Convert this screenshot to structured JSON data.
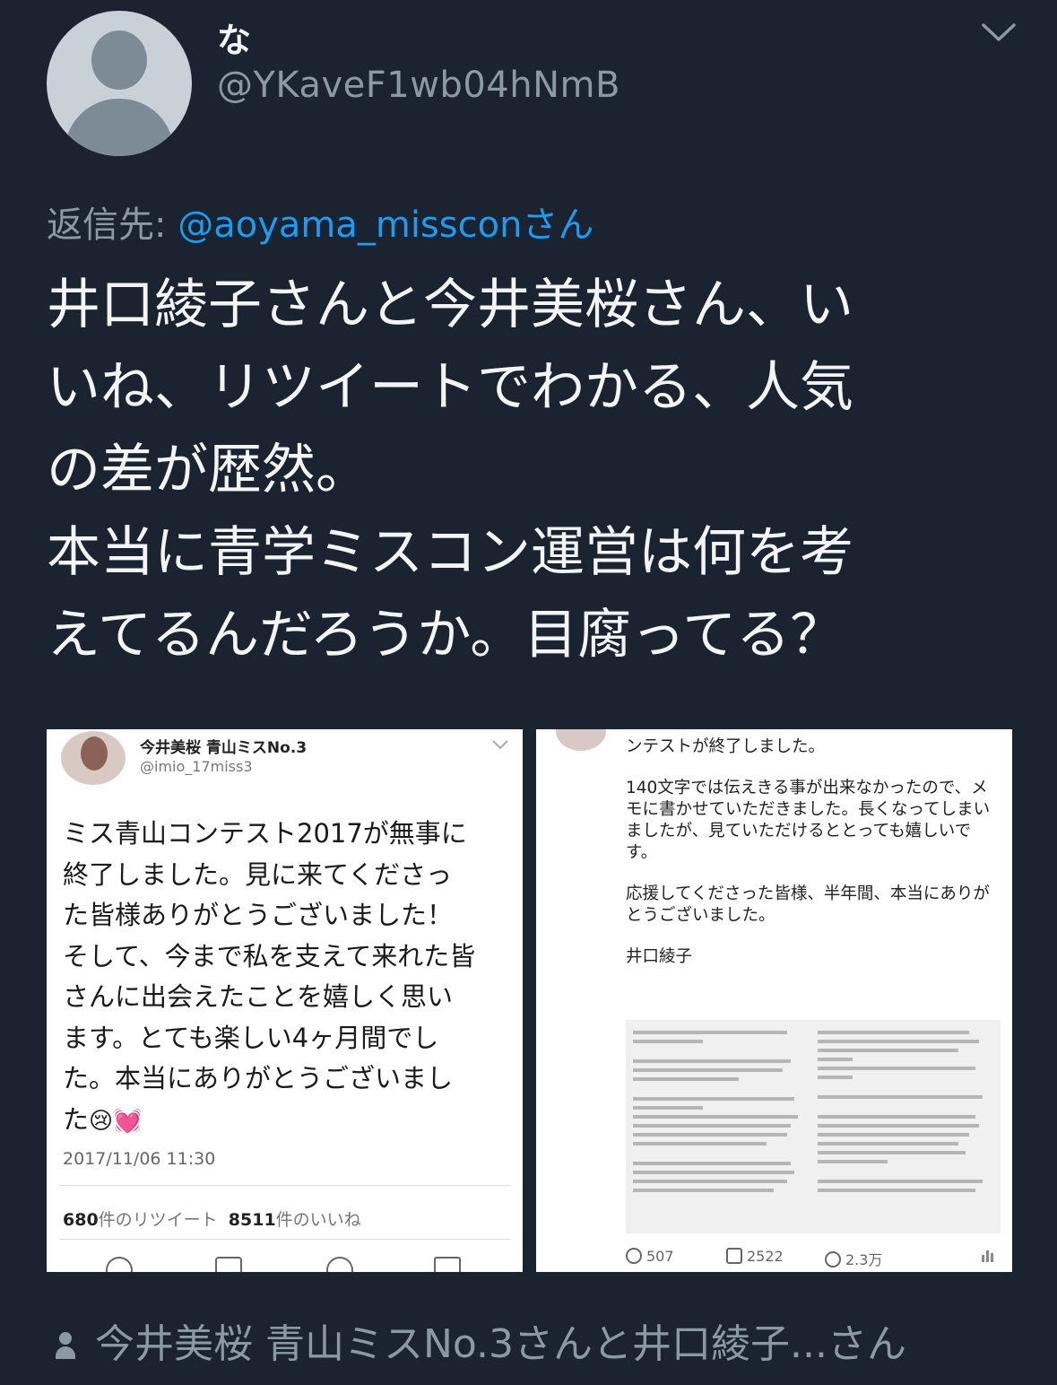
{
  "author": {
    "display_name": "な",
    "handle": "@YKaveF1wb04hNmB"
  },
  "reply": {
    "prefix": "返信先: ",
    "mention": "@aoyama_missconさん"
  },
  "tweet": {
    "text": "井口綾子さんと今井美桜さん、い\nいね、リツイートでわかる、人気\nの差が歴然。\n本当に青学ミスコン運営は何を考\nえてるんだろうか。目腐ってる？"
  },
  "attached_1": {
    "name": "今井美桜 青山ミスNo.3",
    "handle": "@imio_17miss3",
    "body": "ミス青山コンテスト2017が無事に\n終了しました。見に来てくださっ\nた皆様ありがとうございました！\nそして、今まで私を支えて来れた皆\nさんに出会えたことを嬉しく思い\nます。とても楽しい4ヶ月間でし\nた。本当にありがとうございまし\nた",
    "emoji": "😢💓",
    "timestamp": "2017/11/06 11:30",
    "retweets": "680",
    "retweets_label": "件のリツイート",
    "likes": "8511",
    "likes_label": "件のいいね"
  },
  "attached_2": {
    "line1": "ンテストが終了しました。",
    "para1": "140文字では伝えきる事が出来なかったので、メモに書かせていただきました。長くなってしまいましたが、見ていただけるととっても嬉しいです。",
    "para2": "応援してくださった皆様、半年間、本当にありがとうございました。",
    "signature": "井口綾子",
    "replies": "507",
    "retweets": "2522",
    "likes": "2.3万"
  },
  "footer": {
    "text": "今井美桜 青山ミスNo.3さんと井口綾子...さん"
  },
  "colors": {
    "background": "#1b2330",
    "mention": "#1d9bf0",
    "muted": "#8b98a5"
  }
}
